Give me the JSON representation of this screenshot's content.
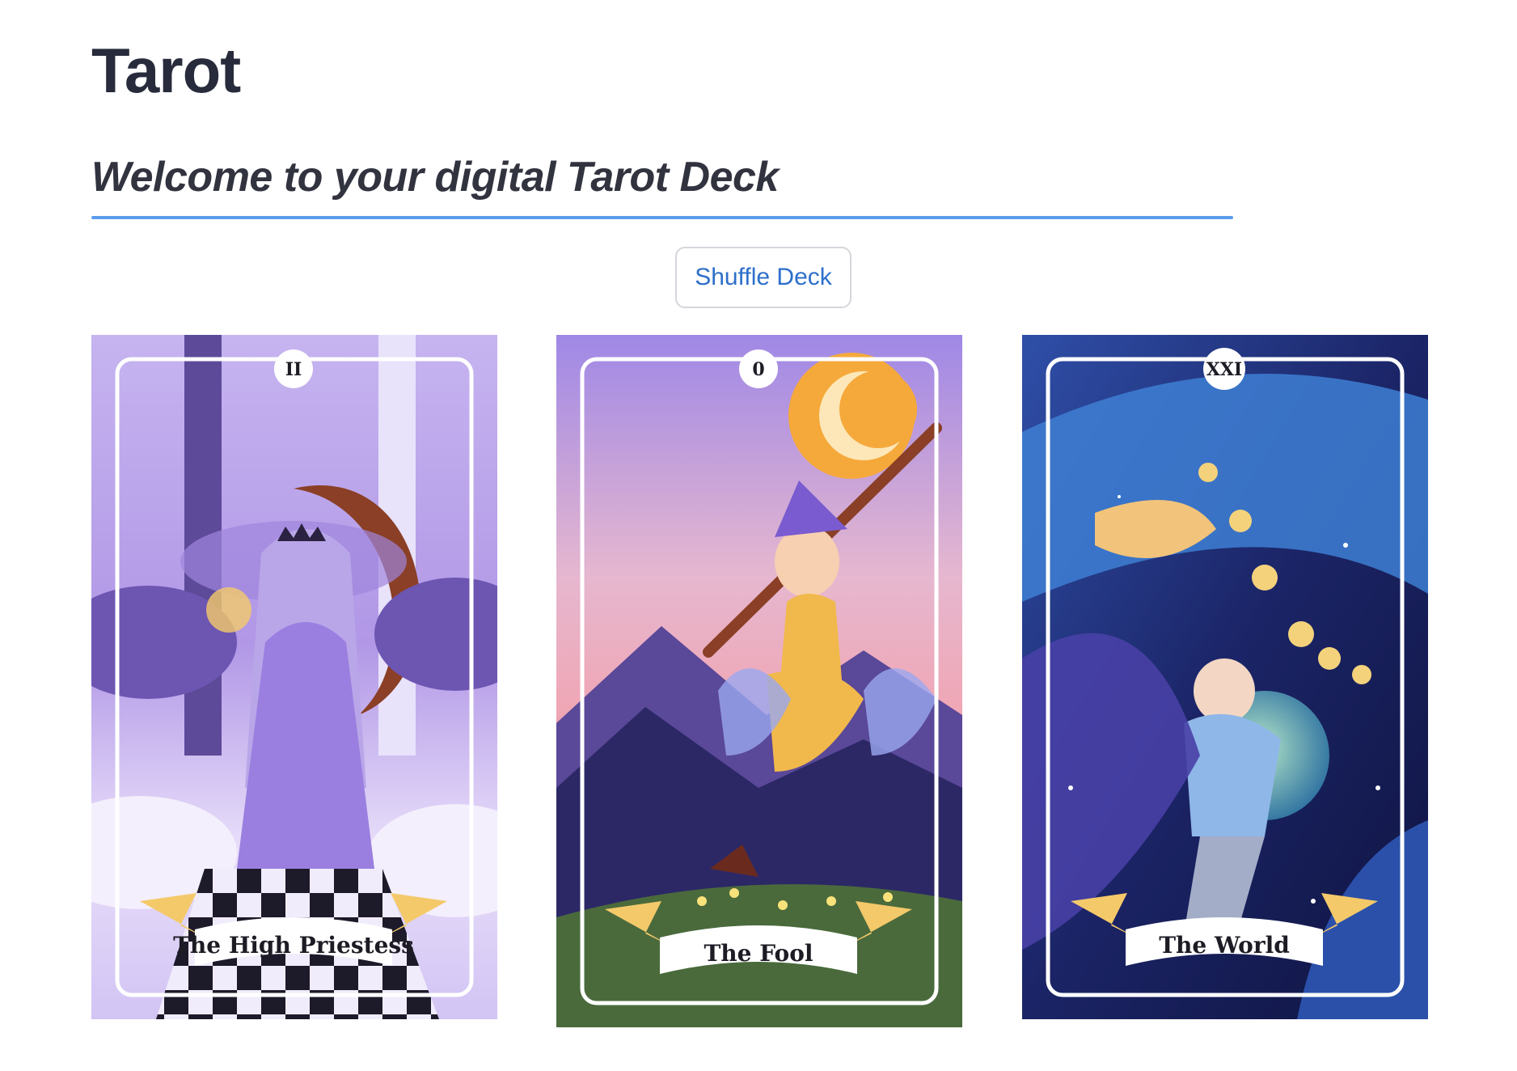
{
  "header": {
    "title": "Tarot",
    "subtitle": "Welcome to your digital Tarot Deck"
  },
  "actions": {
    "shuffle_label": "Shuffle Deck"
  },
  "accent_color": "#5a9cec",
  "button_text_color": "#2e6fcb",
  "cards": [
    {
      "name": "The High Priestess",
      "numeral": "II"
    },
    {
      "name": "The Fool",
      "numeral": "0"
    },
    {
      "name": "The World",
      "numeral": "XXI"
    }
  ]
}
